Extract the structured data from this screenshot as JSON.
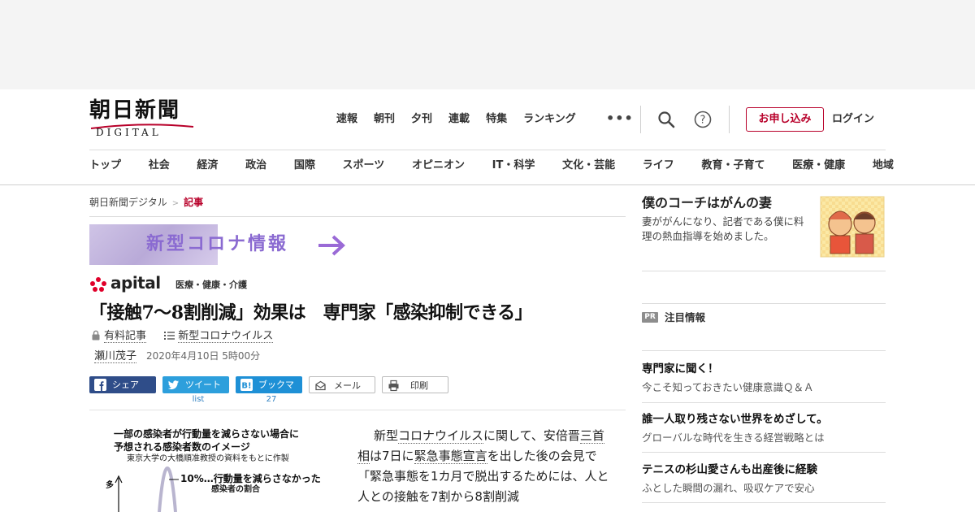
{
  "header": {
    "logo_main": "朝日新聞",
    "logo_sub": "DIGITAL",
    "top_nav": [
      "速報",
      "朝刊",
      "夕刊",
      "連載",
      "特集",
      "ランキング"
    ],
    "more": "•••",
    "signup": "お申し込み",
    "login": "ログイン",
    "categories": [
      "トップ",
      "社会",
      "経済",
      "政治",
      "国際",
      "スポーツ",
      "オピニオン",
      "IT・科学",
      "文化・芸能",
      "ライフ",
      "教育・子育て",
      "医療・健康",
      "地域"
    ]
  },
  "breadcrumb": {
    "home": "朝日新聞デジタル",
    "sep": ">",
    "current": "記事"
  },
  "banner": {
    "corona": "新型コロナ情報"
  },
  "apital": {
    "logo": "apital",
    "category": "医療・健康・介護"
  },
  "article": {
    "headline": "「接触7～8割削減」効果は　専門家「感染抑制できる」",
    "paid_label": "有料記事",
    "topic": "新型コロナウイルス",
    "author": "瀬川茂子",
    "date": "2020年4月10日 5時00分",
    "body_1": "新型",
    "body_link_1": "コロナウイルス",
    "body_2": "に関して、",
    "body_3": "安倍晋",
    "body_link_2": "三首相",
    "body_4": "は7日に",
    "body_link_3": "緊急事態宣言",
    "body_5": "を出した後の会見で「緊急事態を1カ月で脱出するためには、人と人との接触を7割から8割削減",
    "figure": {
      "title_1": "一部の感染者が行動量を減らさない場合に",
      "title_2": "予想される感染者数のイメージ",
      "source": "東京大学の大橋順准教授の資料をもとに作製",
      "pct": "10%…行動量を減らさなかった",
      "pct_2": "感染者の割合",
      "y_label": "多"
    }
  },
  "share": {
    "facebook": "シェア",
    "twitter": "ツイート",
    "twitter_count": "list",
    "hatena": "ブックマーク",
    "hatena_count": "27",
    "mail": "メール",
    "print": "印刷"
  },
  "sidebar": {
    "feature_title": "僕のコーチはがんの妻",
    "feature_desc": "妻ががんになり、記者である僕に料理の熱血指導を始めました。",
    "pr_badge": "PR",
    "pr_label": "注目情報",
    "pr_items": [
      {
        "title": "専門家に聞く！",
        "desc": "今こそ知っておきたい健康意識Ｑ＆Ａ"
      },
      {
        "title": "誰一人取り残さない世界をめざして。",
        "desc": "グローバルな時代を生きる経営戦略とは"
      },
      {
        "title": "テニスの杉山愛さんも出産後に経験",
        "desc": "ふとした瞬間の漏れ、吸収ケアで安心"
      }
    ]
  },
  "colors": {
    "brand_red": "#b8002a",
    "corona_purple": "#8a6ad1",
    "facebook": "#2f4d89",
    "twitter": "#2d9fdc",
    "hatena": "#1e90d6"
  }
}
